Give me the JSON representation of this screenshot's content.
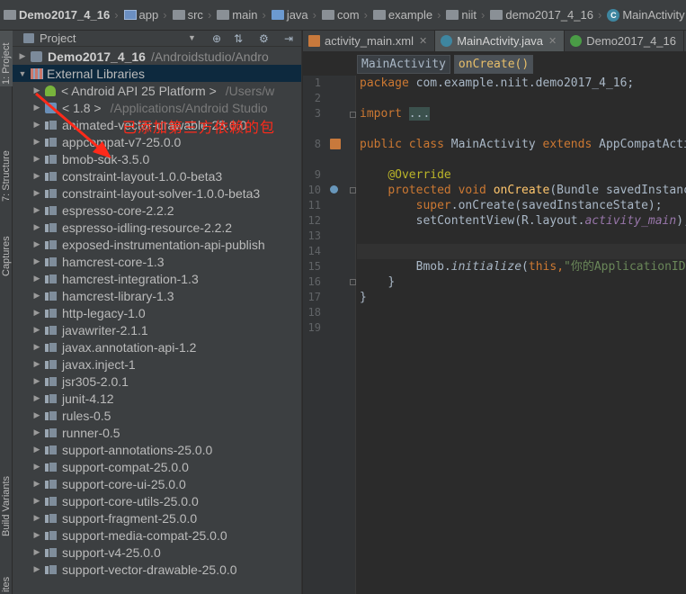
{
  "navbar": {
    "crumbs": [
      "Demo2017_4_16",
      "app",
      "src",
      "main",
      "java",
      "com",
      "example",
      "niit",
      "demo2017_4_16",
      "MainActivity"
    ]
  },
  "left_strip": {
    "tabs": [
      "1: Project",
      "7: Structure",
      "Captures",
      "Build Variants",
      "ites"
    ]
  },
  "project_panel": {
    "title": "Project",
    "tree": {
      "root": {
        "name": "Demo2017_4_16",
        "path": "/Androidstudio/Andro"
      },
      "external_libraries": "External Libraries",
      "sdk": {
        "name": "< Android API 25 Platform >",
        "path": "/Users/w"
      },
      "jdk": {
        "name": "< 1.8 >",
        "path": "/Applications/Android Studio"
      },
      "libraries": [
        "animated-vector-drawable-25.0.0",
        "appcompat-v7-25.0.0",
        "bmob-sdk-3.5.0",
        "constraint-layout-1.0.0-beta3",
        "constraint-layout-solver-1.0.0-beta3",
        "espresso-core-2.2.2",
        "espresso-idling-resource-2.2.2",
        "exposed-instrumentation-api-publish",
        "hamcrest-core-1.3",
        "hamcrest-integration-1.3",
        "hamcrest-library-1.3",
        "http-legacy-1.0",
        "javawriter-2.1.1",
        "javax.annotation-api-1.2",
        "javax.inject-1",
        "jsr305-2.0.1",
        "junit-4.12",
        "rules-0.5",
        "runner-0.5",
        "support-annotations-25.0.0",
        "support-compat-25.0.0",
        "support-core-ui-25.0.0",
        "support-core-utils-25.0.0",
        "support-fragment-25.0.0",
        "support-media-compat-25.0.0",
        "support-v4-25.0.0",
        "support-vector-drawable-25.0.0"
      ]
    }
  },
  "annotation": {
    "text": "已添加第三方依赖的包",
    "color": "#ff2a1a"
  },
  "editor": {
    "tabs": [
      "activity_main.xml",
      "MainActivity.java",
      "Demo2017_4_16"
    ],
    "active_tab": "MainActivity.java",
    "breadcrumbs": [
      "MainActivity",
      "onCreate()"
    ],
    "line_numbers": [
      "1",
      "2",
      "3",
      "8",
      "9",
      "10",
      "11",
      "12",
      "13",
      "14",
      "15",
      "16",
      "17",
      "18",
      "19"
    ],
    "code": {
      "l1_kw": "package",
      "l1_rest": " com.example.niit.demo2017_4_16;",
      "l3_kw": "import",
      "l3_fold": "...",
      "l8_kw": "public class",
      "l8_name": " MainActivity ",
      "l8_kw2": "extends",
      "l8_rest": " AppCompatActivity {",
      "l10_ann": "@Override",
      "l11_kw": "protected void",
      "l11_fn": "onCreate",
      "l11_rest": "(Bundle savedInstanceState) {",
      "l12_kw": "super",
      "l12_rest": ".onCreate(savedInstanceState);",
      "l13_pre": "setContentView(R.layout.",
      "l13_fld": "activity_main",
      "l13_post": ");",
      "l16_pre": "Bmob.",
      "l16_it": "initialize",
      "l16_mid": "(",
      "l16_kw": "this",
      "l16_comma": ",",
      "l16_str": "\"你的ApplicationID\");",
      "l17": "}",
      "l18": "}"
    }
  },
  "colors": {
    "keyword": "#cc7832",
    "annotation": "#bbb529",
    "function": "#ffc66d",
    "string": "#6a8759",
    "field": "#9876aa"
  }
}
